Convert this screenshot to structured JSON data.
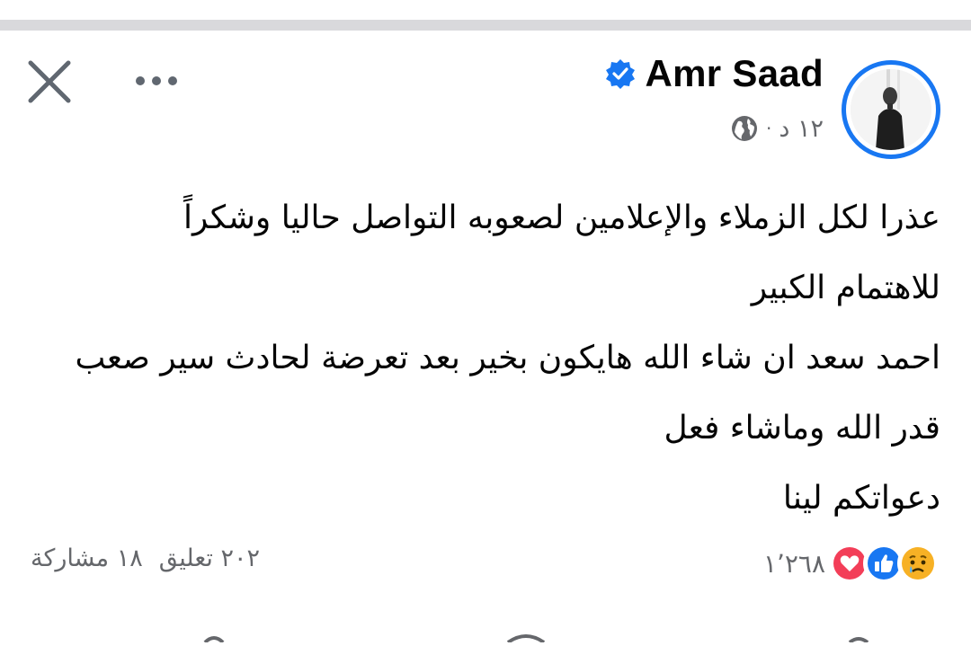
{
  "post": {
    "author": "Amr Saad",
    "verified": true,
    "time": "١٢ د",
    "separator": "·",
    "audience_icon": "globe-icon",
    "lines": [
      "عذرا لكل الزملاء والإعلامين لصعوبه التواصل حاليا  وشكراً",
      "للاهتمام الكبير",
      "احمد سعد ان شاء الله هايكون بخير بعد تعرضة لحادث سير صعب",
      "قدر الله وماشاء فعل",
      "دعواتكم لينا"
    ]
  },
  "stats": {
    "reactions_count": "١٬٢٦٨",
    "reaction_icons": [
      "sad-reaction-icon",
      "like-reaction-icon",
      "love-reaction-icon"
    ],
    "comments": "٢٠٢ تعليق",
    "shares": "١٨ مشاركة"
  },
  "colors": {
    "accent": "#1877f2",
    "love": "#f33e58",
    "sad": "#f7b125",
    "muted_text": "#65676b"
  }
}
